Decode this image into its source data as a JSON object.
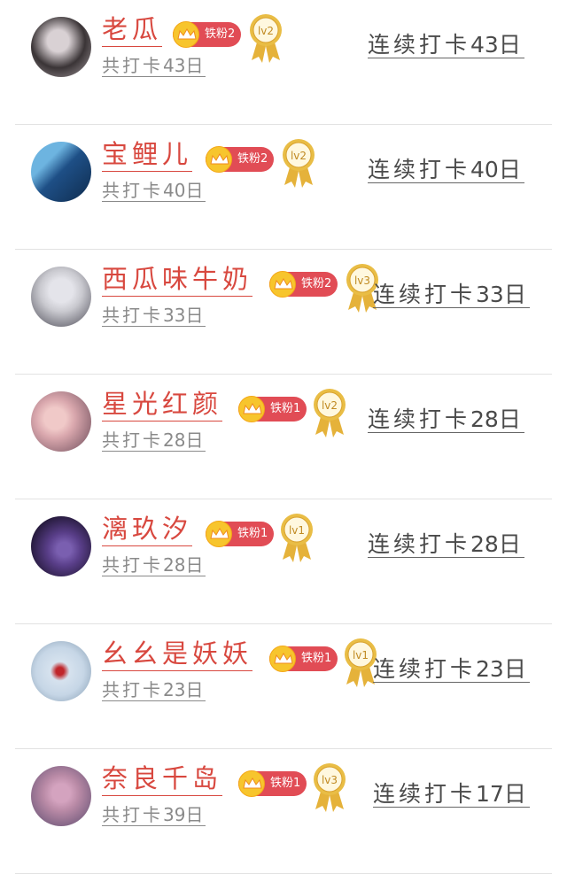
{
  "rows": [
    {
      "name": "老瓜",
      "fan_label": "铁粉2",
      "level": "lv2",
      "streak_prefix": "连续打卡",
      "streak_days": "43",
      "streak_unit": "日",
      "total_prefix": "共打卡",
      "total_days": "43",
      "total_unit": "日",
      "avatar_colors": [
        "#3a3436",
        "#d9d1d4"
      ]
    },
    {
      "name": "宝鲤儿",
      "fan_label": "铁粉2",
      "level": "lv2",
      "streak_prefix": "连续打卡",
      "streak_days": "40",
      "streak_unit": "日",
      "total_prefix": "共打卡",
      "total_days": "40",
      "total_unit": "日",
      "avatar_colors": [
        "#1e4f86",
        "#6db4e0"
      ]
    },
    {
      "name": "西瓜味牛奶",
      "fan_label": "铁粉2",
      "level": "lv3",
      "streak_prefix": "连续打卡",
      "streak_days": "33",
      "streak_unit": "日",
      "total_prefix": "共打卡",
      "total_days": "33",
      "total_unit": "日",
      "avatar_colors": [
        "#c9c9cf",
        "#4b4a55"
      ]
    },
    {
      "name": "星光红颜",
      "fan_label": "铁粉1",
      "level": "lv2",
      "streak_prefix": "连续打卡",
      "streak_days": "28",
      "streak_unit": "日",
      "total_prefix": "共打卡",
      "total_days": "28",
      "total_unit": "日",
      "avatar_colors": [
        "#d9a7ad",
        "#6a4a58"
      ]
    },
    {
      "name": "漓玖汐",
      "fan_label": "铁粉1",
      "level": "lv1",
      "streak_prefix": "连续打卡",
      "streak_days": "28",
      "streak_unit": "日",
      "total_prefix": "共打卡",
      "total_days": "28",
      "total_unit": "日",
      "avatar_colors": [
        "#231838",
        "#5a3f8a"
      ]
    },
    {
      "name": "幺幺是妖妖",
      "fan_label": "铁粉1",
      "level": "lv1",
      "streak_prefix": "连续打卡",
      "streak_days": "23",
      "streak_unit": "日",
      "total_prefix": "共打卡",
      "total_days": "23",
      "total_unit": "日",
      "avatar_colors": [
        "#c6d6e6",
        "#c0262b"
      ]
    },
    {
      "name": "奈良千岛",
      "fan_label": "铁粉1",
      "level": "lv3",
      "streak_prefix": "连续打卡",
      "streak_days": "17",
      "streak_unit": "日",
      "total_prefix": "共打卡",
      "total_days": "39",
      "total_unit": "日",
      "avatar_colors": [
        "#5a4a6e",
        "#b98aa6"
      ]
    }
  ],
  "colors": {
    "name": "#d8483f",
    "fan_bg": "#e14c55",
    "crown_bg": "#f7c52d",
    "medal": "#e5b23a"
  }
}
